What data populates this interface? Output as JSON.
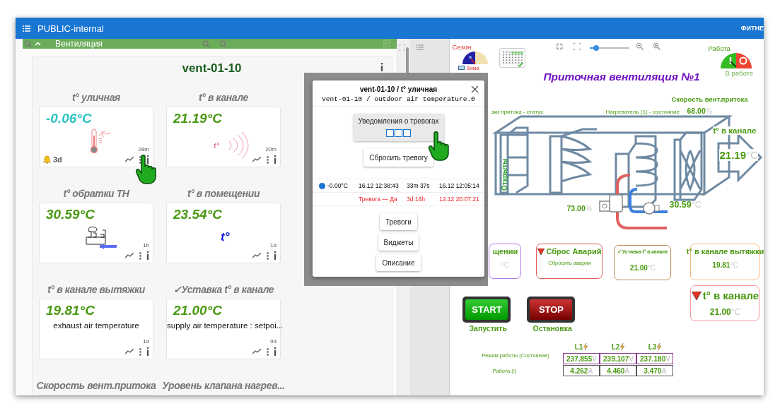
{
  "header": {
    "title": "PUBLIC-internal",
    "right_text": "ФИТНЕ"
  },
  "group": {
    "title": "Вентиляция",
    "expanded": true
  },
  "device": {
    "title": "vent-01-10"
  },
  "widgets": [
    {
      "kind": "thermometer",
      "title": "t° уличная",
      "value": "-0.06°C",
      "color": "#2ec4c4",
      "age": "28m",
      "alarm": "3d"
    },
    {
      "kind": "duct",
      "title": "t° в канале",
      "value": "21.19°C",
      "color": "#4a9a12",
      "age": "20m",
      "icon_text": "t°"
    },
    {
      "kind": "heat_pump",
      "title": "t° обратки ТН",
      "value": "30.59°C",
      "color": "#4a9a12",
      "age": "1h"
    },
    {
      "kind": "room",
      "title": "t° в помещении",
      "value": "23.54°C",
      "color": "#4a9a12",
      "age": "1d",
      "icon_text": "t°"
    },
    {
      "kind": "text",
      "title": "t° в канале вытяжки",
      "value": "19.81°C",
      "color": "#4a9a12",
      "age": "1d",
      "description": "exhaust air temperature"
    },
    {
      "kind": "text",
      "title": "✓Уставка t° в канале",
      "value": "21.00°C",
      "color": "#4a9a12",
      "age": "9d",
      "description": "supply air temperature : setpoi..."
    },
    {
      "kind": "cut",
      "title": "Скорость вент.притока"
    },
    {
      "kind": "cut",
      "title": "Уровень клапана нагрев..."
    }
  ],
  "popup": {
    "title": "vent-01-10 / t° уличная",
    "subtitle": "vent-01-10 / outdoor air temperature.0",
    "notify_button": "Уведомления о тревогах",
    "channels": [
      {
        "checked": false
      },
      {
        "checked": false
      },
      {
        "checked": false
      }
    ],
    "reset_button": "Сбросить тревогу",
    "rows": [
      {
        "kind": "value",
        "color": "#1976d2",
        "cells": [
          "-0.00°C",
          "16.12 12:38:43",
          "33m 37s",
          "16.12 12:05:14"
        ]
      },
      {
        "kind": "alarm",
        "cells": [
          "",
          "Тревога — Да",
          "3d 16h",
          "12.12 20:07:21"
        ]
      }
    ],
    "buttons": [
      "Тревоги",
      "Виджеты",
      "Описание"
    ]
  },
  "scada": {
    "season_label": "Сезон",
    "season": "Зима",
    "zoom": {
      "level": 0.15
    },
    "work_label": "Работа",
    "running": true,
    "work_state": "В работе",
    "title": "Приточная вентиляция №1",
    "fan_label": "Скорость вент.притока",
    "fan_value": "68.00",
    "fan_unit": "%",
    "damper_label": "зки притока - статус",
    "damper_state": "Открыты",
    "heater_label": "Нагреватель (1) - состояние",
    "outlet_label": "t° в канале",
    "outlet_value": "21.19",
    "outlet_unit": "°C",
    "valve_value": "73.00",
    "valve_unit": "%",
    "return_value": "30.59",
    "return_unit": "°C",
    "cards": [
      {
        "kind": "value",
        "title": "щении",
        "alarm": false,
        "color": "#b57be8",
        "unit": "°C"
      },
      {
        "kind": "action",
        "title": "Сброс Аварий",
        "alarm": true,
        "color": "#e05a5a",
        "text": "Сбросить аварии"
      },
      {
        "kind": "value",
        "title": "✓Уставка t° в канале",
        "alarm": false,
        "color": "#c08850",
        "value": "21.00",
        "unit": "°C"
      },
      {
        "kind": "value",
        "title": "t° в канале вытяжки",
        "alarm": false,
        "color": "#f6b880",
        "value": "19.81",
        "unit": "°C"
      },
      {
        "kind": "value",
        "title": "t° в канале",
        "alarm": true,
        "color": "#f59aa0",
        "value": "21.00",
        "unit": "°C"
      }
    ],
    "start": {
      "label": "START",
      "caption": "Запустить"
    },
    "stop": {
      "label": "STOP",
      "caption": "Остановка"
    },
    "phases": [
      "L1",
      "L2",
      "L3"
    ],
    "power_rows": [
      {
        "label": "Режим работы (Состояние)",
        "cells": [
          {
            "value": "237.855",
            "unit": "V"
          },
          {
            "value": "239.107",
            "unit": "V"
          },
          {
            "value": "237.180",
            "unit": "V"
          }
        ]
      },
      {
        "label": "Работа (!)",
        "cells": [
          {
            "value": "4.262",
            "unit": "A"
          },
          {
            "value": "4.460",
            "unit": "A"
          },
          {
            "value": "3.470",
            "unit": "A"
          }
        ]
      }
    ]
  }
}
